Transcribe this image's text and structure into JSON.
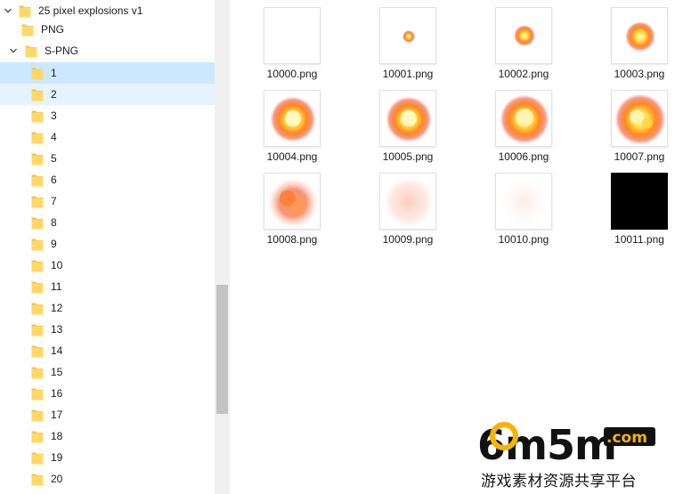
{
  "tree": {
    "root": {
      "label": "25 pixel explosions v1",
      "expanded": true
    },
    "children": [
      {
        "label": "PNG",
        "expanded": false,
        "has_children": false
      },
      {
        "label": "S-PNG",
        "expanded": true,
        "has_children": true
      }
    ],
    "subfolders": [
      {
        "label": "1",
        "state": "selected"
      },
      {
        "label": "2",
        "state": "hover"
      },
      {
        "label": "3"
      },
      {
        "label": "4"
      },
      {
        "label": "5"
      },
      {
        "label": "6"
      },
      {
        "label": "7"
      },
      {
        "label": "8"
      },
      {
        "label": "9"
      },
      {
        "label": "10"
      },
      {
        "label": "11"
      },
      {
        "label": "12"
      },
      {
        "label": "13"
      },
      {
        "label": "14"
      },
      {
        "label": "15"
      },
      {
        "label": "16"
      },
      {
        "label": "17"
      },
      {
        "label": "18"
      },
      {
        "label": "19"
      },
      {
        "label": "20"
      }
    ]
  },
  "files": [
    {
      "name": "10000.png",
      "preview": "empty"
    },
    {
      "name": "10001.png",
      "preview": "tiny-spark"
    },
    {
      "name": "10002.png",
      "preview": "small-burst"
    },
    {
      "name": "10003.png",
      "preview": "medium-burst"
    },
    {
      "name": "10004.png",
      "preview": "bright-fireball"
    },
    {
      "name": "10005.png",
      "preview": "bright-fireball"
    },
    {
      "name": "10006.png",
      "preview": "large-fireball"
    },
    {
      "name": "10007.png",
      "preview": "large-fireball-flicker"
    },
    {
      "name": "10008.png",
      "preview": "dissipating-orange-smoke"
    },
    {
      "name": "10009.png",
      "preview": "faint-pink-smoke"
    },
    {
      "name": "10010.png",
      "preview": "very-faint-smoke"
    },
    {
      "name": "10011.png",
      "preview": "black"
    }
  ],
  "watermark": {
    "logo_text": "6m5m",
    "domain": ".com",
    "tagline": "游戏素材资源共享平台",
    "colors": {
      "logo_dark": "#111111",
      "logo_accent": "#f5b400"
    }
  },
  "colors": {
    "folder_fill": "#ffd867",
    "folder_tab": "#f2c24d",
    "selected_bg": "#cce8ff",
    "hover_bg": "#e5f3ff"
  }
}
